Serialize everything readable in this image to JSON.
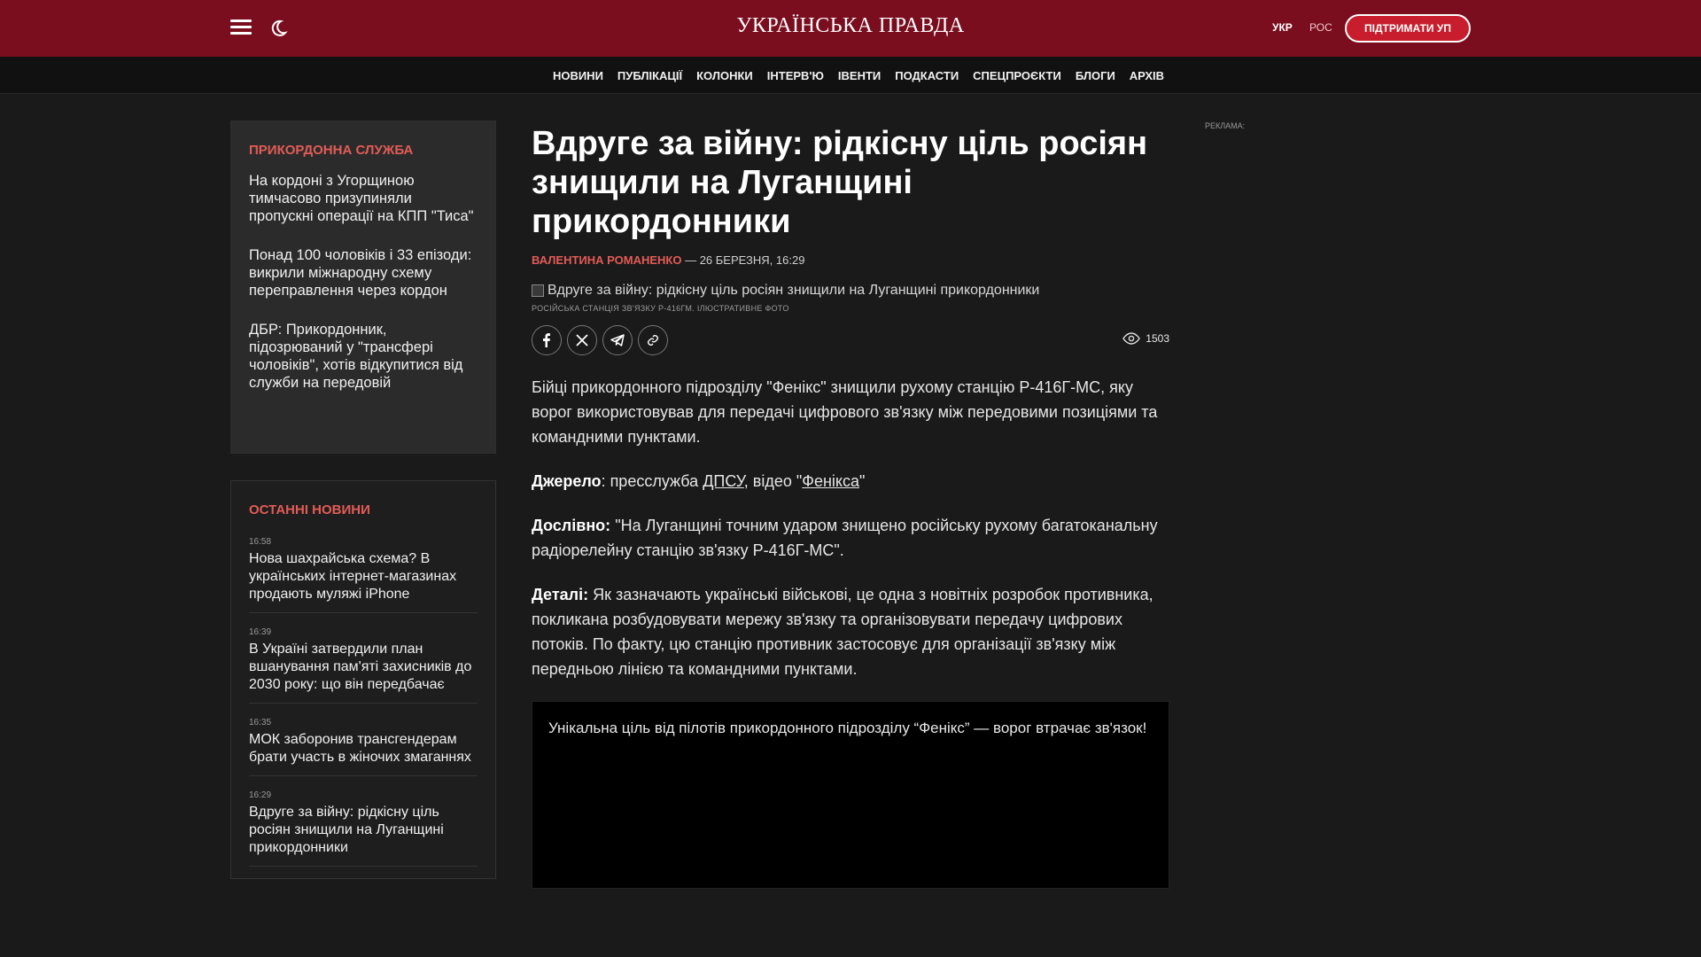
{
  "header": {
    "logo": "УКРАЇНСЬКА ПРАВДА",
    "lang_ukr": "УКР",
    "lang_ros": "РОС",
    "support_button": "ПІДТРИМАТИ УП",
    "icons": [
      "menu-icon",
      "moon-icon"
    ]
  },
  "nav": {
    "items": [
      "НОВИНИ",
      "ПУБЛІКАЦІЇ",
      "КОЛОНКИ",
      "ІНТЕРВ'Ю",
      "ІВЕНТИ",
      "ПОДКАСТИ",
      "СПЕЦПРОЄКТИ",
      "БЛОГИ",
      "АРХІВ"
    ]
  },
  "sidebar_border": {
    "title": "ПРИКОРДОННА СЛУЖБА",
    "items": [
      "На кордоні з Угорщиною тимчасово призупиняли пропускні операції на КПП \"Тиса\"",
      "Понад 100 чоловіків і 33 епізоди: викрили міжнародну схему переправлення через кордон",
      "ДБР: Прикордонник, підозрюваний у \"трансфері чоловіків\", хотів відкупитися від служби на передовій"
    ]
  },
  "latest_news": {
    "title": "ОСТАННІ НОВИНИ",
    "items": [
      {
        "time": "16:58",
        "title": "Нова шахрайська схема? В українських інтернет-магазинах продають муляжі iPhone"
      },
      {
        "time": "16:39",
        "title": "В Україні затвердили план вшанування пам'яті захисників до 2030 року: що він передбачає"
      },
      {
        "time": "16:35",
        "title": "МОК заборонив трансгендерам брати участь в жіночих змаганнях"
      },
      {
        "time": "16:29",
        "title": "Вдруге за війну: рідкісну ціль росіян знищили на Луганщині прикордонники"
      }
    ]
  },
  "article": {
    "headline": "Вдруге за війну: рідкісну ціль росіян знищили на Луганщині прикордонники",
    "author": "ВАЛЕНТИНА РОМАНЕНКО",
    "date": "— 26 БЕРЕЗНЯ, 16:29",
    "image_alt": "Вдруге за війну: рідкісну ціль росіян знищили на Луганщині прикордонники",
    "caption": "РОСІЙСЬКА СТАНЦІЯ ЗВ'ЯЗКУ Р-416ГМ. ІЛЮСТРАТИВНЕ ФОТО",
    "views": "1503",
    "share_icons": [
      "facebook-icon",
      "x-icon",
      "telegram-icon",
      "link-icon"
    ],
    "p1": "Бійці прикордонного підрозділу \"Фенікс\" знищили рухому станцію Р-416Г-МС, яку ворог використовував для передачі цифрового зв'язку між передовими позиціями та командними пунктами.",
    "p2_label": "Джерело",
    "p2_text1": ": пресслужба ",
    "p2_link1": "ДПСУ",
    "p2_text2": ", відео \"",
    "p2_link2": "Фенікса",
    "p2_text3": "\"",
    "p3_label": "Дослівно:",
    "p3_text": " \"На Луганщині точним ударом знищено російську рухому багатоканальну радіорелейну станцію зв'язку Р-416Г-МС\".",
    "p4_label": "Деталі:",
    "p4_text": " Як зазначають українські військові, це одна з новітніх розробок противника, покликана розбудовувати мережу зв'язку та організовувати передачу цифрових потоків. По факту, цю станцію противник застосовує для організації зв'язку між передньою лінією та командними пунктами.",
    "video_title": "Унікальна ціль від пілотів прикордонного підрозділу “Фенікс” — ворог втрачає зв'язок!"
  },
  "ad": {
    "label": "РЕКЛАМА:"
  },
  "colors": {
    "topbar": "#7a0d1e",
    "accent": "#e25c56",
    "background": "#1a1a1a"
  }
}
